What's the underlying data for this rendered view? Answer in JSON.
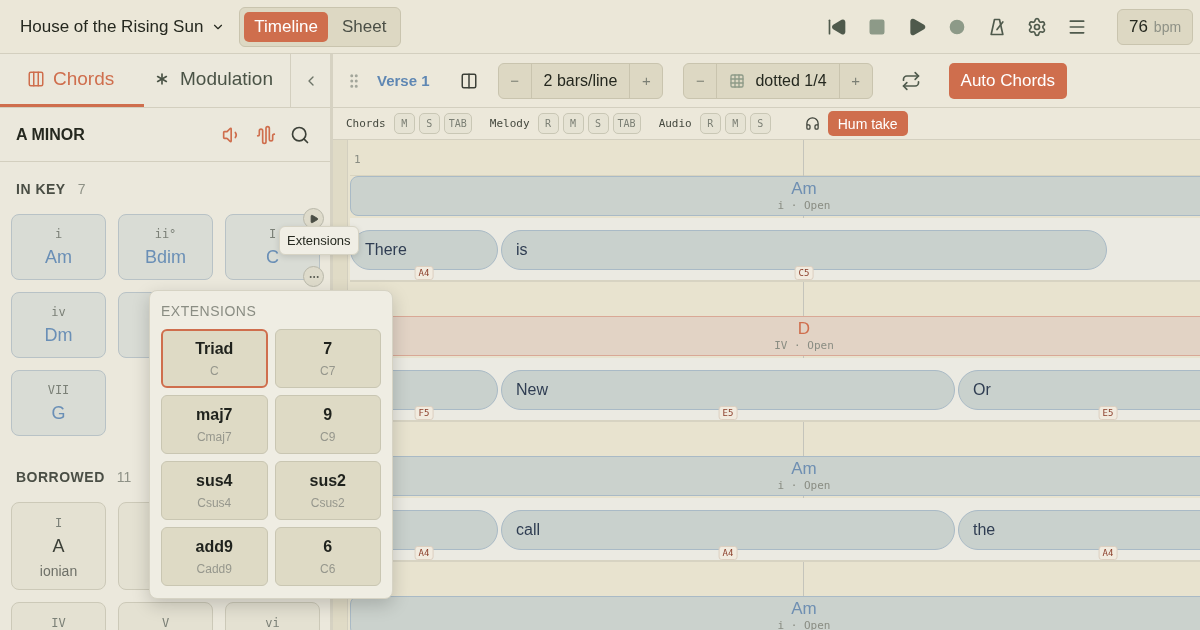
{
  "header": {
    "song_title": "House of the Rising Sun",
    "views": [
      {
        "label": "Timeline",
        "selected": true
      },
      {
        "label": "Sheet",
        "selected": false
      }
    ],
    "tempo": {
      "value": "76",
      "unit": "bpm"
    }
  },
  "sidebar": {
    "tabs": [
      {
        "label": "Chords",
        "selected": true
      },
      {
        "label": "Modulation",
        "selected": false
      }
    ],
    "key": "A MINOR",
    "sections": [
      {
        "title": "IN KEY",
        "count": "7",
        "kind": "diatonic",
        "chords": [
          {
            "kind": "card",
            "roman": "i",
            "name": "Am"
          },
          {
            "kind": "card",
            "roman": "ii°",
            "name": "Bdim"
          },
          {
            "kind": "card",
            "roman": "I",
            "name": "C"
          },
          {
            "kind": "card",
            "roman": "iv",
            "name": "Dm"
          },
          {
            "kind": "card"
          },
          {
            "kind": "hidden"
          },
          {
            "kind": "card",
            "roman": "VII",
            "name": "G"
          }
        ]
      },
      {
        "title": "BORROWED",
        "count": "11",
        "kind": "borrowed",
        "chords": [
          {
            "kind": "card",
            "roman": "I",
            "name": "A",
            "mode": "ionian"
          },
          {
            "kind": "card"
          },
          {
            "kind": "hidden"
          },
          {
            "kind": "card",
            "roman": "IV"
          },
          {
            "kind": "card",
            "roman": "V"
          },
          {
            "kind": "card",
            "roman": "vi"
          }
        ]
      }
    ]
  },
  "extensions": {
    "tooltip": "Extensions",
    "title": "EXTENSIONS",
    "options": [
      {
        "label": "Triad",
        "chord": "C",
        "selected": true
      },
      {
        "label": "7",
        "chord": "C7",
        "selected": false
      },
      {
        "label": "maj7",
        "chord": "Cmaj7",
        "selected": false
      },
      {
        "label": "9",
        "chord": "C9",
        "selected": false
      },
      {
        "label": "sus4",
        "chord": "Csus4",
        "selected": false
      },
      {
        "label": "sus2",
        "chord": "Csus2",
        "selected": false
      },
      {
        "label": "add9",
        "chord": "Cadd9",
        "selected": false
      },
      {
        "label": "6",
        "chord": "C6",
        "selected": false
      }
    ]
  },
  "toolbar": {
    "section_name": "Verse 1",
    "steppers": [
      {
        "kind": "bars",
        "decrement": "−",
        "value": "2 bars/line",
        "increment": "+"
      },
      {
        "kind": "grid",
        "decrement": "−",
        "value": "dotted 1/4",
        "increment": "+"
      }
    ],
    "auto_chords": "Auto Chords"
  },
  "tracks": {
    "groups": [
      {
        "name": "Chords",
        "buttons": [
          "M",
          "S",
          "TAB"
        ]
      },
      {
        "name": "Melody",
        "buttons": [
          "R",
          "M",
          "S",
          "TAB"
        ]
      },
      {
        "name": "Audio",
        "buttons": [
          "R",
          "M",
          "S"
        ]
      }
    ],
    "hum_take": "Hum take"
  },
  "timeline": {
    "bar_number": "1",
    "lines": [
      {
        "chord": {
          "name": "Am",
          "label": "i · Open",
          "selected": false
        },
        "lyrics": [
          {
            "word": "There",
            "note": "A4"
          },
          {
            "word": "is",
            "note": "C5"
          }
        ]
      },
      {
        "chord": {
          "name": "D",
          "label": "IV · Open",
          "selected": true
        },
        "lyrics": [
          {
            "note": "F5"
          },
          {
            "word": "New",
            "note": "E5"
          },
          {
            "word": "Or",
            "note": "E5"
          }
        ]
      },
      {
        "chord": {
          "name": "Am",
          "label": "i · Open",
          "selected": false
        },
        "lyrics": [
          {
            "note": "A4"
          },
          {
            "word": "call",
            "note": "A4"
          },
          {
            "word": "the",
            "note": "A4"
          }
        ]
      },
      {
        "chord": {
          "name": "Am",
          "label": "i · Open",
          "selected": false
        }
      }
    ]
  }
}
